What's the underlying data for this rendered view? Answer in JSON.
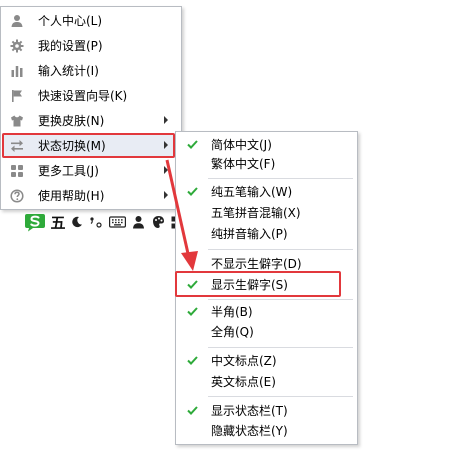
{
  "main_menu": {
    "items": [
      {
        "label": "个人中心(L)",
        "icon": "user-icon",
        "has_submenu": false
      },
      {
        "label": "我的设置(P)",
        "icon": "gear-icon",
        "has_submenu": false
      },
      {
        "label": "输入统计(I)",
        "icon": "bar-chart-icon",
        "has_submenu": false
      },
      {
        "label": "快速设置向导(K)",
        "icon": "flag-icon",
        "has_submenu": false
      },
      {
        "label": "更换皮肤(N)",
        "icon": "shirt-icon",
        "has_submenu": true
      },
      {
        "label": "状态切换(M)",
        "icon": "swap-arrows-icon",
        "has_submenu": true,
        "highlighted": true
      },
      {
        "label": "更多工具(J)",
        "icon": "grid-icon",
        "has_submenu": true
      },
      {
        "label": "使用帮助(H)",
        "icon": "help-icon",
        "has_submenu": true
      }
    ]
  },
  "submenu": {
    "groups": [
      [
        {
          "label": "简体中文(J)",
          "checked": true
        },
        {
          "label": "繁体中文(F)",
          "checked": false
        }
      ],
      [
        {
          "label": "纯五笔输入(W)",
          "checked": true
        },
        {
          "label": "五笔拼音混输(X)",
          "checked": false
        },
        {
          "label": "纯拼音输入(P)",
          "checked": false
        }
      ],
      [
        {
          "label": "不显示生僻字(D)",
          "checked": false
        },
        {
          "label": "显示生僻字(S)",
          "checked": true
        }
      ],
      [
        {
          "label": "半角(B)",
          "checked": true
        },
        {
          "label": "全角(Q)",
          "checked": false
        }
      ],
      [
        {
          "label": "中文标点(Z)",
          "checked": true
        },
        {
          "label": "英文标点(E)",
          "checked": false
        }
      ],
      [
        {
          "label": "显示状态栏(T)",
          "checked": true
        },
        {
          "label": "隐藏状态栏(Y)",
          "checked": false
        }
      ]
    ]
  },
  "toolbar": {
    "mode_label": "五",
    "items": [
      "sogou-logo-icon",
      "mode-text",
      "moon-icon",
      "punctuation-icon",
      "keyboard-icon",
      "user-status-icon",
      "skin-icon",
      "toolbox-icon"
    ]
  },
  "colors": {
    "check": "#2eaa3a",
    "annotation_red": "#e2383c",
    "highlight_bg": "#e8ecf4",
    "menu_icon": "#8a8a8a",
    "sogou_green": "#2eaa3a"
  }
}
